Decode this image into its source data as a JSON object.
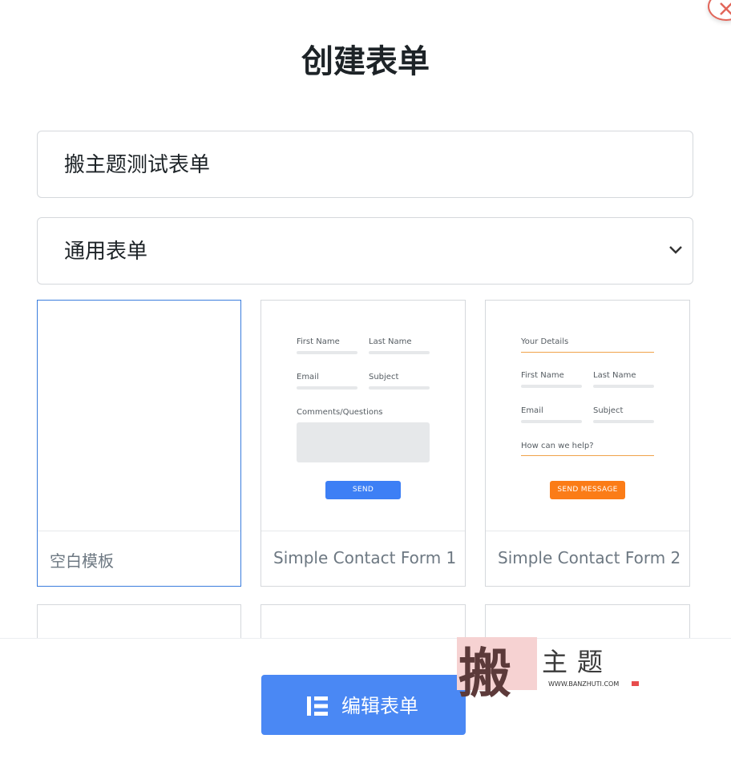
{
  "dialog": {
    "title": "创建表单",
    "close_icon": "close-icon"
  },
  "form_name": {
    "value": "搬主题测试表单"
  },
  "form_type": {
    "selected": "通用表单",
    "icon": "chevron-down-icon"
  },
  "templates": [
    {
      "label": "空白模板",
      "selected": true
    },
    {
      "label": "Simple Contact Form 1",
      "preview": {
        "first_name": "First Name",
        "last_name": "Last Name",
        "email": "Email",
        "subject": "Subject",
        "comments": "Comments/Questions",
        "button": "SEND"
      }
    },
    {
      "label": "Simple Contact Form 2",
      "preview": {
        "heading": "Your Details",
        "first_name": "First Name",
        "last_name": "Last Name",
        "email": "Email",
        "subject": "Subject",
        "help": "How can we help?",
        "button": "SEND MESSAGE"
      }
    }
  ],
  "footer": {
    "edit_button": "编辑表单",
    "edit_icon": "elementor-icon"
  },
  "watermark": {
    "big": "搬",
    "small": "主题",
    "url": "WWW.BANZHUTI.COM"
  },
  "colors": {
    "accent": "#4a88f4",
    "selected_border": "#3b7ddd",
    "orange": "#fb7c17",
    "close": "#e2665a"
  }
}
